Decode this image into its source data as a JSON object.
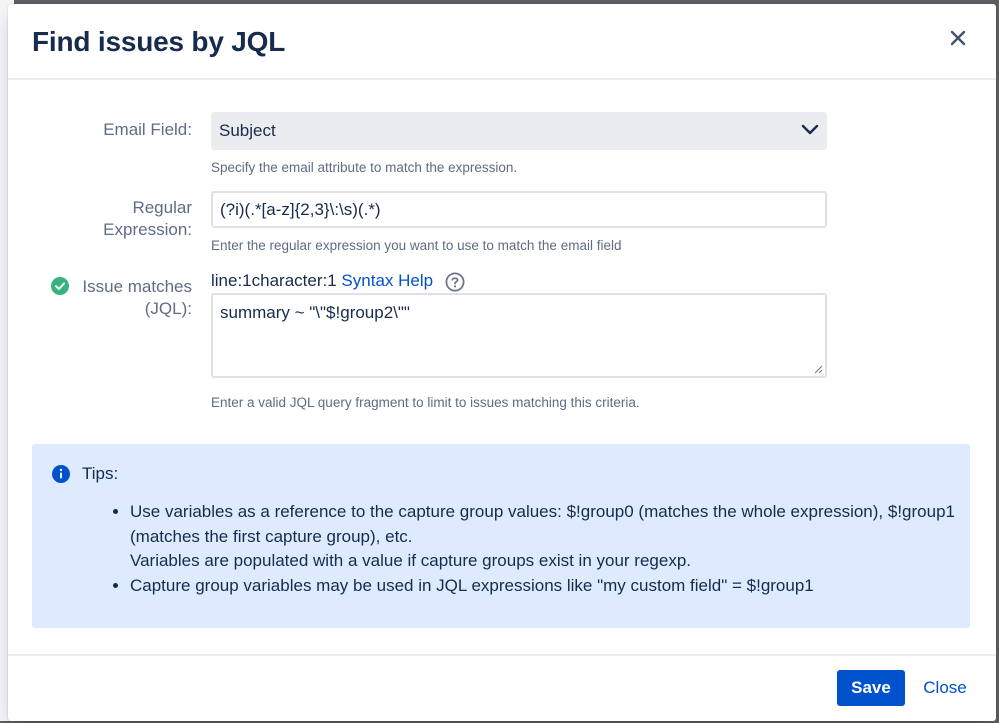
{
  "dialog": {
    "title": "Find issues by JQL"
  },
  "email_field": {
    "label": "Email Field:",
    "value": "Subject",
    "help": "Specify the email attribute to match the expression."
  },
  "regex": {
    "label_line1": "Regular",
    "label_line2": "Expression:",
    "value": "(?i)(.*[a-z]{2,3}\\:\\s)(.*)",
    "help": "Enter the regular expression you want to use to match the email field"
  },
  "jql": {
    "label_line1": "Issue matches",
    "label_line2": "(JQL):",
    "status": "line:1character:1",
    "syntax_help": "Syntax Help",
    "value": "summary ~ \"\\\"$!group2\\\"\"",
    "help": "Enter a valid JQL query fragment to limit to issues matching this criteria."
  },
  "tips": {
    "heading": "Tips:",
    "item1_line1": "Use variables as a reference to the capture group values: $!group0 (matches the whole expression), $!group1 (matches the first capture group), etc.",
    "item1_line2": "Variables are populated with a value if capture groups exist in your regexp.",
    "item2": "Capture group variables may be used in JQL expressions like \"my custom field\" = $!group1"
  },
  "footer": {
    "save_label": "Save",
    "close_label": "Close"
  },
  "colors": {
    "primary": "#0052cc",
    "success": "#36b37e",
    "info_bg": "#deebff",
    "text": "#172b4d",
    "subtle_text": "#5e6c84"
  },
  "icons": {
    "close": "close-icon",
    "chevron": "chevron-down-icon",
    "help": "question-circle-icon",
    "valid": "check-circle-icon",
    "info": "info-icon"
  }
}
